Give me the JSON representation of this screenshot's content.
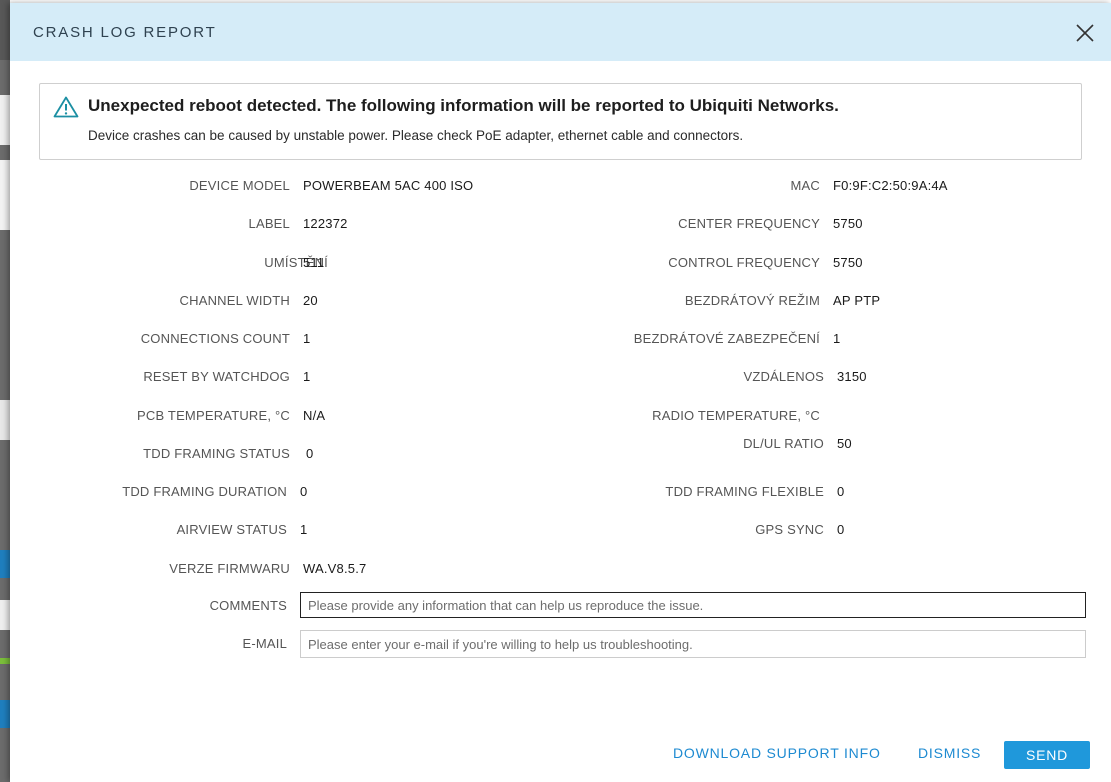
{
  "modal": {
    "title": "CRASH LOG REPORT",
    "alert_title": "Unexpected reboot detected. The following information will be reported to Ubiquiti Networks.",
    "alert_text": "Device crashes can be caused by unstable power. Please check PoE adapter, ethernet cable and connectors."
  },
  "left_fields": [
    {
      "label": "DEVICE MODEL",
      "value": "POWERBEAM 5AC 400 ISO"
    },
    {
      "label": "LABEL",
      "value": "122372"
    },
    {
      "label": "UMÍSTĚNÍ",
      "value": "511"
    },
    {
      "label": "CHANNEL WIDTH",
      "value": "20"
    },
    {
      "label": "CONNECTIONS COUNT",
      "value": "1"
    },
    {
      "label": "RESET BY WATCHDOG",
      "value": "1"
    },
    {
      "label": "PCB TEMPERATURE, °C",
      "value": "N/A"
    },
    {
      "label": "TDD FRAMING STATUS",
      "value": "0"
    },
    {
      "label": "TDD FRAMING DURATION",
      "value": "0"
    },
    {
      "label": "AIRVIEW STATUS",
      "value": "1"
    },
    {
      "label": "VERZE FIRMWARU",
      "value": "WA.V8.5.7"
    }
  ],
  "right_fields": [
    {
      "label": "MAC",
      "value": "F0:9F:C2:50:9A:4A"
    },
    {
      "label": "CENTER FREQUENCY",
      "value": "5750"
    },
    {
      "label": "CONTROL FREQUENCY",
      "value": "5750"
    },
    {
      "label": "BEZDRÁTOVÝ REŽIM",
      "value": "AP PTP"
    },
    {
      "label": "BEZDRÁTOVÉ ZABEZPEČENÍ",
      "value": "1"
    },
    {
      "label": "VZDÁLENOS",
      "value": "3150"
    },
    {
      "label": "RADIO TEMPERATURE, °C",
      "value": ""
    },
    {
      "label": "DL/UL RATIO",
      "value": "50"
    },
    {
      "label": "TDD FRAMING FLEXIBLE",
      "value": "0"
    },
    {
      "label": "GPS SYNC",
      "value": "0"
    }
  ],
  "form": {
    "comments_label": "COMMENTS",
    "comments_placeholder": "Please provide any information that can help us reproduce the issue.",
    "comments_value": "",
    "email_label": "E-MAIL",
    "email_placeholder": "Please enter your e-mail if you're willing to help us troubleshooting.",
    "email_value": ""
  },
  "footer": {
    "download_label": "DOWNLOAD SUPPORT INFO",
    "dismiss_label": "DISMISS",
    "send_label": "SEND"
  },
  "icons": {
    "close": "close-icon",
    "warning": "warning-triangle-icon"
  },
  "colors": {
    "header_bg": "#d5ecf8",
    "accent": "#1f98db",
    "link": "#1d8ad1",
    "warning_icon": "#1b8fa3"
  }
}
